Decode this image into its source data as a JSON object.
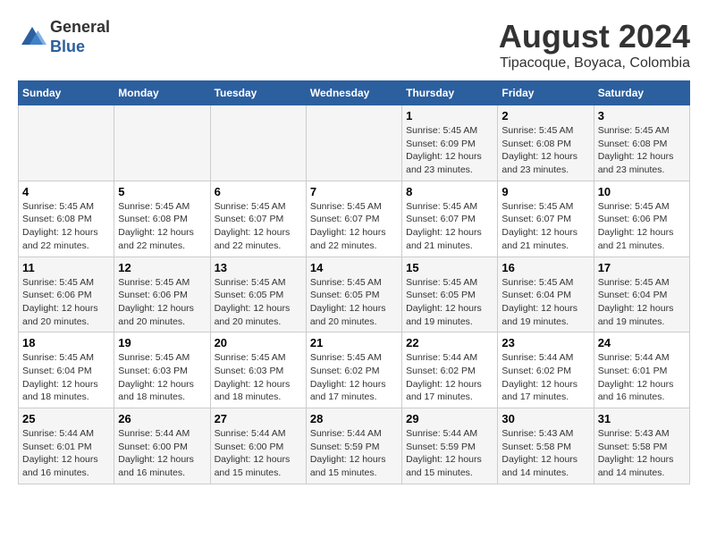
{
  "logo": {
    "general": "General",
    "blue": "Blue"
  },
  "title": "August 2024",
  "subtitle": "Tipacoque, Boyaca, Colombia",
  "weekdays": [
    "Sunday",
    "Monday",
    "Tuesday",
    "Wednesday",
    "Thursday",
    "Friday",
    "Saturday"
  ],
  "weeks": [
    [
      {
        "day": "",
        "detail": ""
      },
      {
        "day": "",
        "detail": ""
      },
      {
        "day": "",
        "detail": ""
      },
      {
        "day": "",
        "detail": ""
      },
      {
        "day": "1",
        "sunrise": "5:45 AM",
        "sunset": "6:09 PM",
        "daylight": "12 hours and 23 minutes."
      },
      {
        "day": "2",
        "sunrise": "5:45 AM",
        "sunset": "6:08 PM",
        "daylight": "12 hours and 23 minutes."
      },
      {
        "day": "3",
        "sunrise": "5:45 AM",
        "sunset": "6:08 PM",
        "daylight": "12 hours and 23 minutes."
      }
    ],
    [
      {
        "day": "4",
        "sunrise": "5:45 AM",
        "sunset": "6:08 PM",
        "daylight": "12 hours and 22 minutes."
      },
      {
        "day": "5",
        "sunrise": "5:45 AM",
        "sunset": "6:08 PM",
        "daylight": "12 hours and 22 minutes."
      },
      {
        "day": "6",
        "sunrise": "5:45 AM",
        "sunset": "6:07 PM",
        "daylight": "12 hours and 22 minutes."
      },
      {
        "day": "7",
        "sunrise": "5:45 AM",
        "sunset": "6:07 PM",
        "daylight": "12 hours and 22 minutes."
      },
      {
        "day": "8",
        "sunrise": "5:45 AM",
        "sunset": "6:07 PM",
        "daylight": "12 hours and 21 minutes."
      },
      {
        "day": "9",
        "sunrise": "5:45 AM",
        "sunset": "6:07 PM",
        "daylight": "12 hours and 21 minutes."
      },
      {
        "day": "10",
        "sunrise": "5:45 AM",
        "sunset": "6:06 PM",
        "daylight": "12 hours and 21 minutes."
      }
    ],
    [
      {
        "day": "11",
        "sunrise": "5:45 AM",
        "sunset": "6:06 PM",
        "daylight": "12 hours and 20 minutes."
      },
      {
        "day": "12",
        "sunrise": "5:45 AM",
        "sunset": "6:06 PM",
        "daylight": "12 hours and 20 minutes."
      },
      {
        "day": "13",
        "sunrise": "5:45 AM",
        "sunset": "6:05 PM",
        "daylight": "12 hours and 20 minutes."
      },
      {
        "day": "14",
        "sunrise": "5:45 AM",
        "sunset": "6:05 PM",
        "daylight": "12 hours and 20 minutes."
      },
      {
        "day": "15",
        "sunrise": "5:45 AM",
        "sunset": "6:05 PM",
        "daylight": "12 hours and 19 minutes."
      },
      {
        "day": "16",
        "sunrise": "5:45 AM",
        "sunset": "6:04 PM",
        "daylight": "12 hours and 19 minutes."
      },
      {
        "day": "17",
        "sunrise": "5:45 AM",
        "sunset": "6:04 PM",
        "daylight": "12 hours and 19 minutes."
      }
    ],
    [
      {
        "day": "18",
        "sunrise": "5:45 AM",
        "sunset": "6:04 PM",
        "daylight": "12 hours and 18 minutes."
      },
      {
        "day": "19",
        "sunrise": "5:45 AM",
        "sunset": "6:03 PM",
        "daylight": "12 hours and 18 minutes."
      },
      {
        "day": "20",
        "sunrise": "5:45 AM",
        "sunset": "6:03 PM",
        "daylight": "12 hours and 18 minutes."
      },
      {
        "day": "21",
        "sunrise": "5:45 AM",
        "sunset": "6:02 PM",
        "daylight": "12 hours and 17 minutes."
      },
      {
        "day": "22",
        "sunrise": "5:44 AM",
        "sunset": "6:02 PM",
        "daylight": "12 hours and 17 minutes."
      },
      {
        "day": "23",
        "sunrise": "5:44 AM",
        "sunset": "6:02 PM",
        "daylight": "12 hours and 17 minutes."
      },
      {
        "day": "24",
        "sunrise": "5:44 AM",
        "sunset": "6:01 PM",
        "daylight": "12 hours and 16 minutes."
      }
    ],
    [
      {
        "day": "25",
        "sunrise": "5:44 AM",
        "sunset": "6:01 PM",
        "daylight": "12 hours and 16 minutes."
      },
      {
        "day": "26",
        "sunrise": "5:44 AM",
        "sunset": "6:00 PM",
        "daylight": "12 hours and 16 minutes."
      },
      {
        "day": "27",
        "sunrise": "5:44 AM",
        "sunset": "6:00 PM",
        "daylight": "12 hours and 15 minutes."
      },
      {
        "day": "28",
        "sunrise": "5:44 AM",
        "sunset": "5:59 PM",
        "daylight": "12 hours and 15 minutes."
      },
      {
        "day": "29",
        "sunrise": "5:44 AM",
        "sunset": "5:59 PM",
        "daylight": "12 hours and 15 minutes."
      },
      {
        "day": "30",
        "sunrise": "5:43 AM",
        "sunset": "5:58 PM",
        "daylight": "12 hours and 14 minutes."
      },
      {
        "day": "31",
        "sunrise": "5:43 AM",
        "sunset": "5:58 PM",
        "daylight": "12 hours and 14 minutes."
      }
    ]
  ],
  "labels": {
    "sunrise": "Sunrise:",
    "sunset": "Sunset:",
    "daylight": "Daylight:"
  }
}
